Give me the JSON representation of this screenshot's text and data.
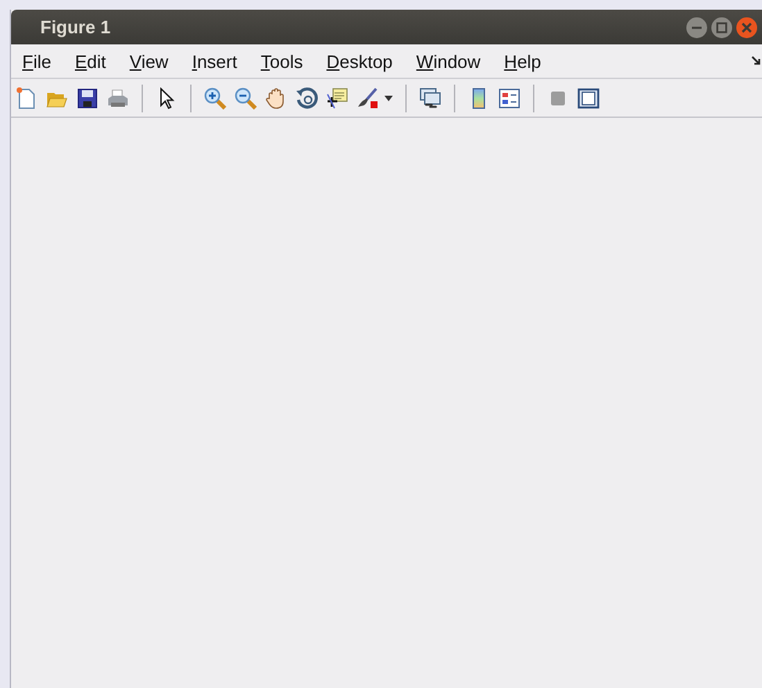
{
  "window": {
    "title": "Figure 1"
  },
  "menu": [
    {
      "label": "File"
    },
    {
      "label": "Edit"
    },
    {
      "label": "View"
    },
    {
      "label": "Insert"
    },
    {
      "label": "Tools"
    },
    {
      "label": "Desktop"
    },
    {
      "label": "Window"
    },
    {
      "label": "Help"
    }
  ]
}
